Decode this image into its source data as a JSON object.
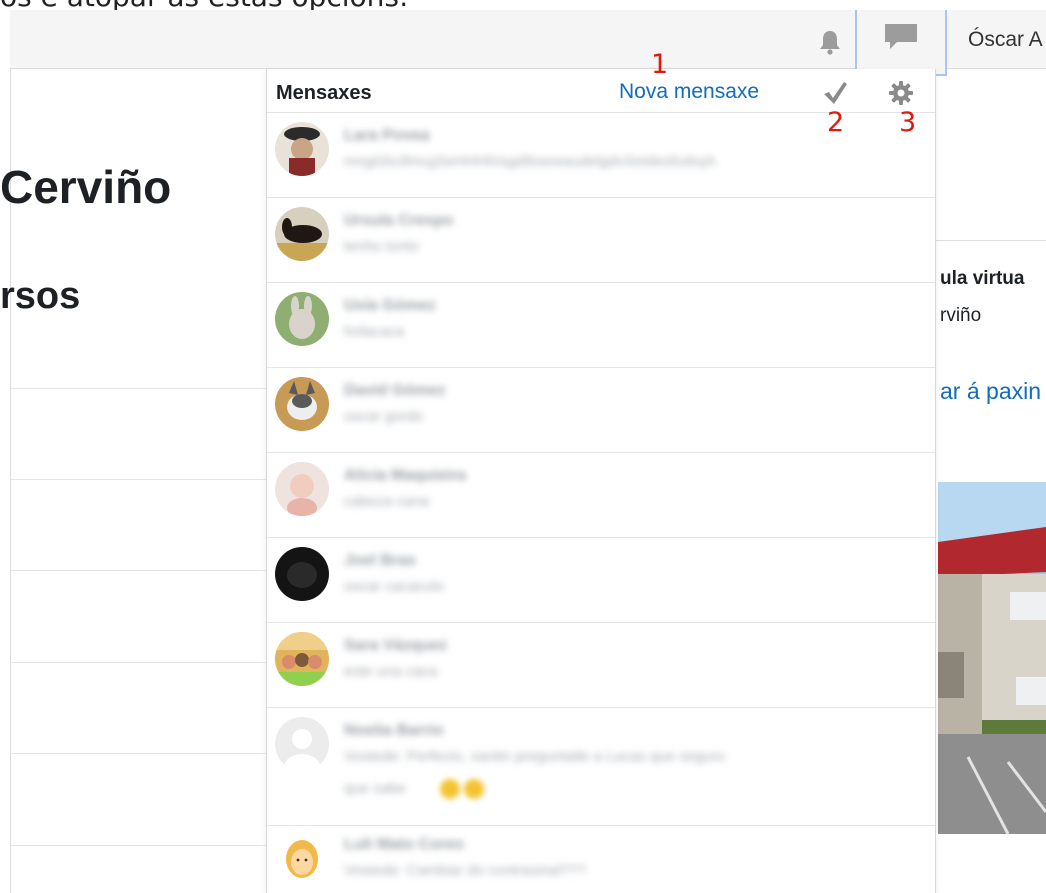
{
  "caption": "os e atopar as estas opcións:",
  "navbar": {
    "user_name": "Óscar A",
    "bell_icon": "bell-icon",
    "chat_icon": "speech-bubble-icon"
  },
  "page": {
    "course_heading": "Cerviño",
    "courses_heading": "rsos"
  },
  "right_card": {
    "title": "ula virtua",
    "subtitle": "rviño",
    "link": "ar á paxin"
  },
  "messages": {
    "title": "Mensaxes",
    "new_message": "Nova mensaxe",
    "mark_all_read_icon": "check-icon",
    "settings_icon": "gear-icon",
    "callouts": [
      "1",
      "2",
      "3"
    ],
    "conversations": [
      {
        "name": "Lara Povea",
        "message": "mngGbcifmcgSeHHHh/sgdIbsewaudelgdvSetdesfudoyh",
        "avatar_color": "#7a3a2a"
      },
      {
        "name": "Ursula Crespo",
        "message": "tenho tonto",
        "avatar_color": "#3a3024"
      },
      {
        "name": "Uxía Gómez",
        "message": "holacaca",
        "avatar_color": "#8fae72"
      },
      {
        "name": "David Gómez",
        "message": "oscar gordo",
        "avatar_color": "#c79a55"
      },
      {
        "name": "Alicia Maquieira",
        "message": "cabeza cana",
        "avatar_color": "#e8cfc6"
      },
      {
        "name": "Joel Bras",
        "message": "oscar cacaculo",
        "avatar_color": "#141414"
      },
      {
        "name": "Sara Vázquez",
        "message": "este una caca",
        "avatar_color": "#e0b35d"
      },
      {
        "name": "Noelia Barrio",
        "message": "Vostede: Perfecto, xantin preguntaile a Lucas que seguro",
        "message_line2": "que sabe",
        "avatar_color": "#e2e2e2"
      },
      {
        "name": "Luli Mato Cores",
        "message": "Vostede: Cambiar do contrasinal???",
        "avatar_color": "#f2b94a"
      }
    ]
  }
}
